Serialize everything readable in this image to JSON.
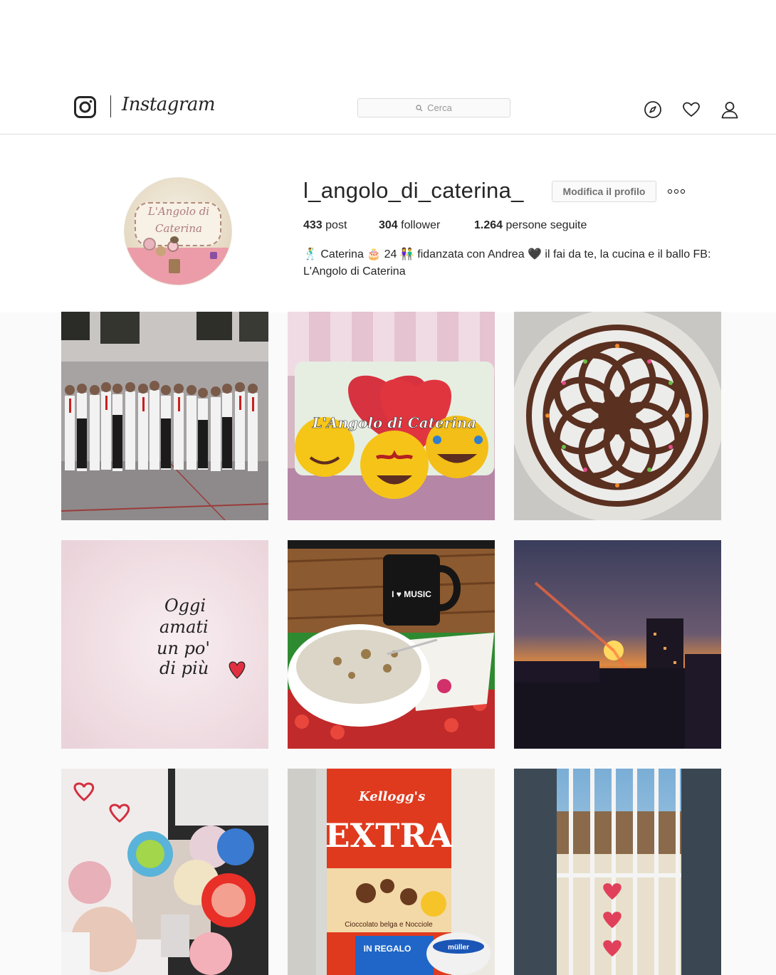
{
  "nav": {
    "wordmark": "Instagram",
    "search_placeholder": "Cerca",
    "icons": [
      "instagram-glyph-icon",
      "compass-icon",
      "heart-icon",
      "user-icon"
    ]
  },
  "profile": {
    "username": "l_angolo_di_caterina_",
    "edit_label": "Modifica il profilo",
    "more_label": "○○○",
    "avatar_text_line1": "L'Angolo di",
    "avatar_text_line2": "Caterina",
    "stats": {
      "posts_count": "433",
      "posts_label": "post",
      "followers_count": "304",
      "followers_label": "follower",
      "following_count": "1.264",
      "following_label": "persone seguite"
    },
    "bio_line1": "🕺 Caterina 🎂 24 👫 fidanzata con Andrea 🖤 il fai da te, la cucina e il ballo FB:",
    "bio_line2": "L'Angolo di Caterina"
  },
  "posts": [
    {
      "subject": "dance-group-photo"
    },
    {
      "subject": "emoji-cushions-photo",
      "overlay_text": "L'Angolo di Caterina"
    },
    {
      "subject": "decorated-cake-photo"
    },
    {
      "subject": "handwritten-quote-photo",
      "text_lines": [
        "Oggi",
        "amati",
        "un po'",
        "di più"
      ]
    },
    {
      "subject": "breakfast-bowl-photo",
      "mug_text": "I ♥ MUSIC"
    },
    {
      "subject": "sunset-photo"
    },
    {
      "subject": "baking-cups-photo"
    },
    {
      "subject": "cereal-box-photo",
      "box_brand": "Kellogg's",
      "box_title": "EXTRA",
      "box_sub": "Cioccolato belga e Nocciole",
      "box_promo": "IN REGALO",
      "yogurt_brand": "müller"
    },
    {
      "subject": "window-view-photo"
    }
  ],
  "colors": {
    "border": "#dbdbdb",
    "text": "#262626",
    "muted": "#999999",
    "background": "#fafafa"
  }
}
